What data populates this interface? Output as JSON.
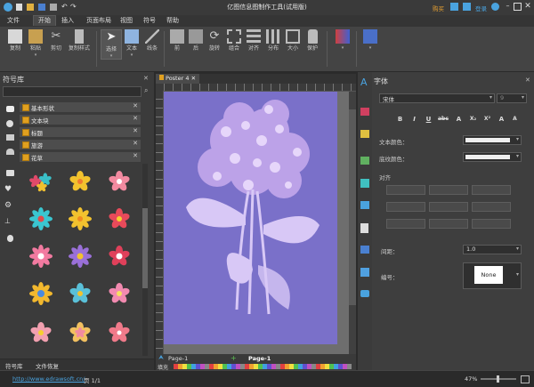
{
  "window": {
    "title": "亿图信息图制作工具(试用版)",
    "buy": "购买",
    "login": "登录"
  },
  "menu": [
    "文件",
    "开始",
    "插入",
    "页面布局",
    "视图",
    "符号",
    "帮助"
  ],
  "ribbon": {
    "groups": [
      {
        "name": "clipboard",
        "buttons": [
          "复制",
          "粘贴",
          "剪切",
          "复制样式"
        ]
      },
      {
        "name": "tools",
        "buttons": [
          "选择",
          "文本",
          "线条"
        ]
      },
      {
        "name": "arrange",
        "buttons": [
          "前",
          "后",
          "旋转",
          "组合",
          "对齐",
          "分布",
          "大小",
          "保护"
        ]
      }
    ]
  },
  "symbol_library": {
    "title": "符号库",
    "categories": [
      "基本形状",
      "文本块",
      "标题",
      "旅游",
      "花草"
    ]
  },
  "left_tabs": [
    "符号库",
    "文件恢复"
  ],
  "document": {
    "tab": "Poster 4"
  },
  "pagebar": {
    "page_left": "Page-1",
    "page_active": "Page-1"
  },
  "colorbar_label": "填充",
  "right_panel": {
    "title": "字体",
    "font_name": "宋体",
    "font_size": "9",
    "format_buttons": [
      "B",
      "I",
      "U",
      "abc",
      "A",
      "X₂",
      "X²",
      "A",
      "A"
    ],
    "text_color_label": "文本颜色：",
    "highlight_label": "底纹颜色：",
    "align_label": "对齐",
    "spacing_label": "间距：",
    "spacing_value": "1.0",
    "numbering_label": "编号：",
    "numbering_value": "None"
  },
  "status": {
    "url": "http://www.edrawsoft.cn/",
    "page": "页 1/1",
    "zoom": "47%"
  },
  "colors": {
    "page": "#7a70c9",
    "accent": "#4aa3df",
    "buy": "#e8a030",
    "bg": "#2b2b2b"
  },
  "flowers": [
    "bouquet-icon",
    "yellow-flower-icon",
    "pink-flower-icon",
    "teal-flower-icon",
    "yellow-daisy-icon",
    "red-flower-icon",
    "pink-rose-icon",
    "purple-flower-icon",
    "heart-flower-icon",
    "sunflower-icon",
    "blue-flower-icon",
    "pink-lotus-icon",
    "pink-star-flower-icon",
    "mixed-flower-icon",
    "star-flower-icon"
  ]
}
